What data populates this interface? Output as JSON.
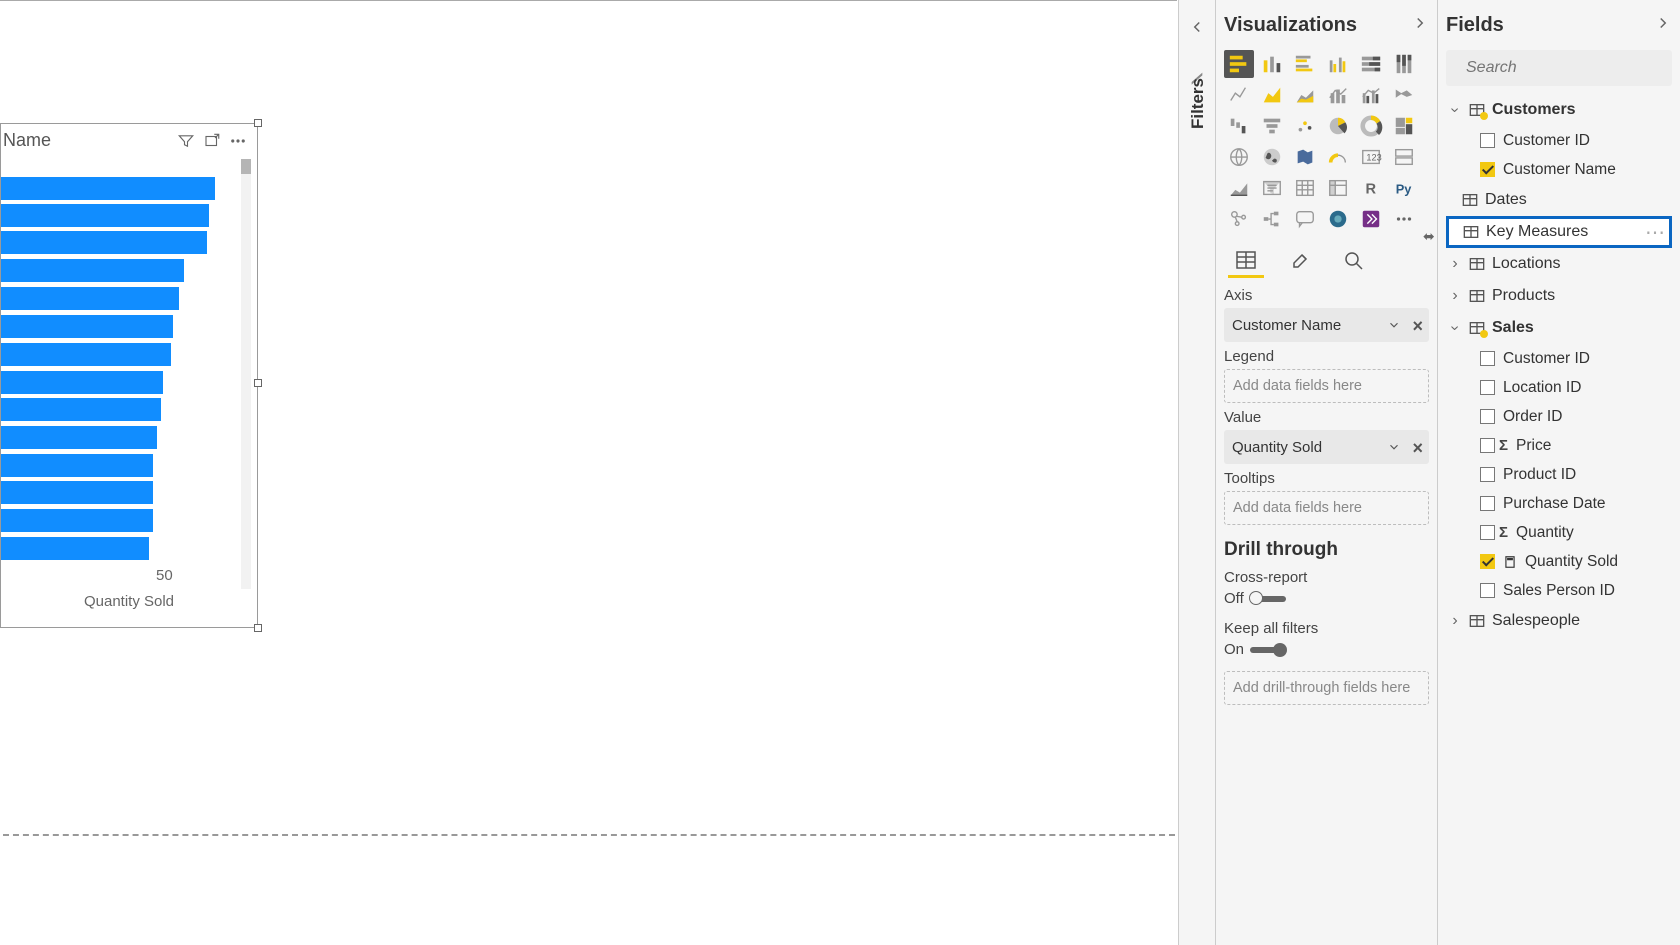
{
  "chart_data": {
    "type": "bar",
    "orientation": "horizontal",
    "title": "Name",
    "xlabel": "Quantity Sold",
    "xticks": [
      50
    ],
    "xlim": [
      0,
      70
    ],
    "values": [
      66,
      64,
      63,
      56,
      55,
      53,
      52,
      50,
      49,
      48,
      47,
      47,
      47,
      46
    ]
  },
  "chart": {
    "title_fragment": "Name",
    "axis_label": "Quantity Sold",
    "tick": "50"
  },
  "filters": {
    "label": "Filters"
  },
  "viz": {
    "pane_title": "Visualizations",
    "sections": {
      "axis": {
        "label": "Axis",
        "value": "Customer Name"
      },
      "legend": {
        "label": "Legend",
        "placeholder": "Add data fields here"
      },
      "value": {
        "label": "Value",
        "value": "Quantity Sold"
      },
      "tooltips": {
        "label": "Tooltips",
        "placeholder": "Add data fields here"
      }
    },
    "drill": {
      "heading": "Drill through",
      "cross_report": {
        "label": "Cross-report",
        "state": "Off"
      },
      "keep_filters": {
        "label": "Keep all filters",
        "state": "On"
      },
      "placeholder": "Add drill-through fields here"
    }
  },
  "fields": {
    "pane_title": "Fields",
    "search_placeholder": "Search",
    "tables": {
      "customers": {
        "name": "Customers",
        "fields": [
          {
            "name": "Customer ID",
            "checked": false
          },
          {
            "name": "Customer Name",
            "checked": true
          }
        ]
      },
      "dates": {
        "name": "Dates"
      },
      "key_measures": {
        "name": "Key Measures"
      },
      "locations": {
        "name": "Locations"
      },
      "products": {
        "name": "Products"
      },
      "sales": {
        "name": "Sales",
        "fields": [
          {
            "name": "Customer ID",
            "checked": false
          },
          {
            "name": "Location ID",
            "checked": false
          },
          {
            "name": "Order ID",
            "checked": false
          },
          {
            "name": "Price",
            "checked": false,
            "sigma": true
          },
          {
            "name": "Product ID",
            "checked": false
          },
          {
            "name": "Purchase Date",
            "checked": false
          },
          {
            "name": "Quantity",
            "checked": false,
            "sigma": true
          },
          {
            "name": "Quantity Sold",
            "checked": true,
            "calc": true
          },
          {
            "name": "Sales Person ID",
            "checked": false
          }
        ]
      },
      "salespeople": {
        "name": "Salespeople"
      }
    }
  }
}
